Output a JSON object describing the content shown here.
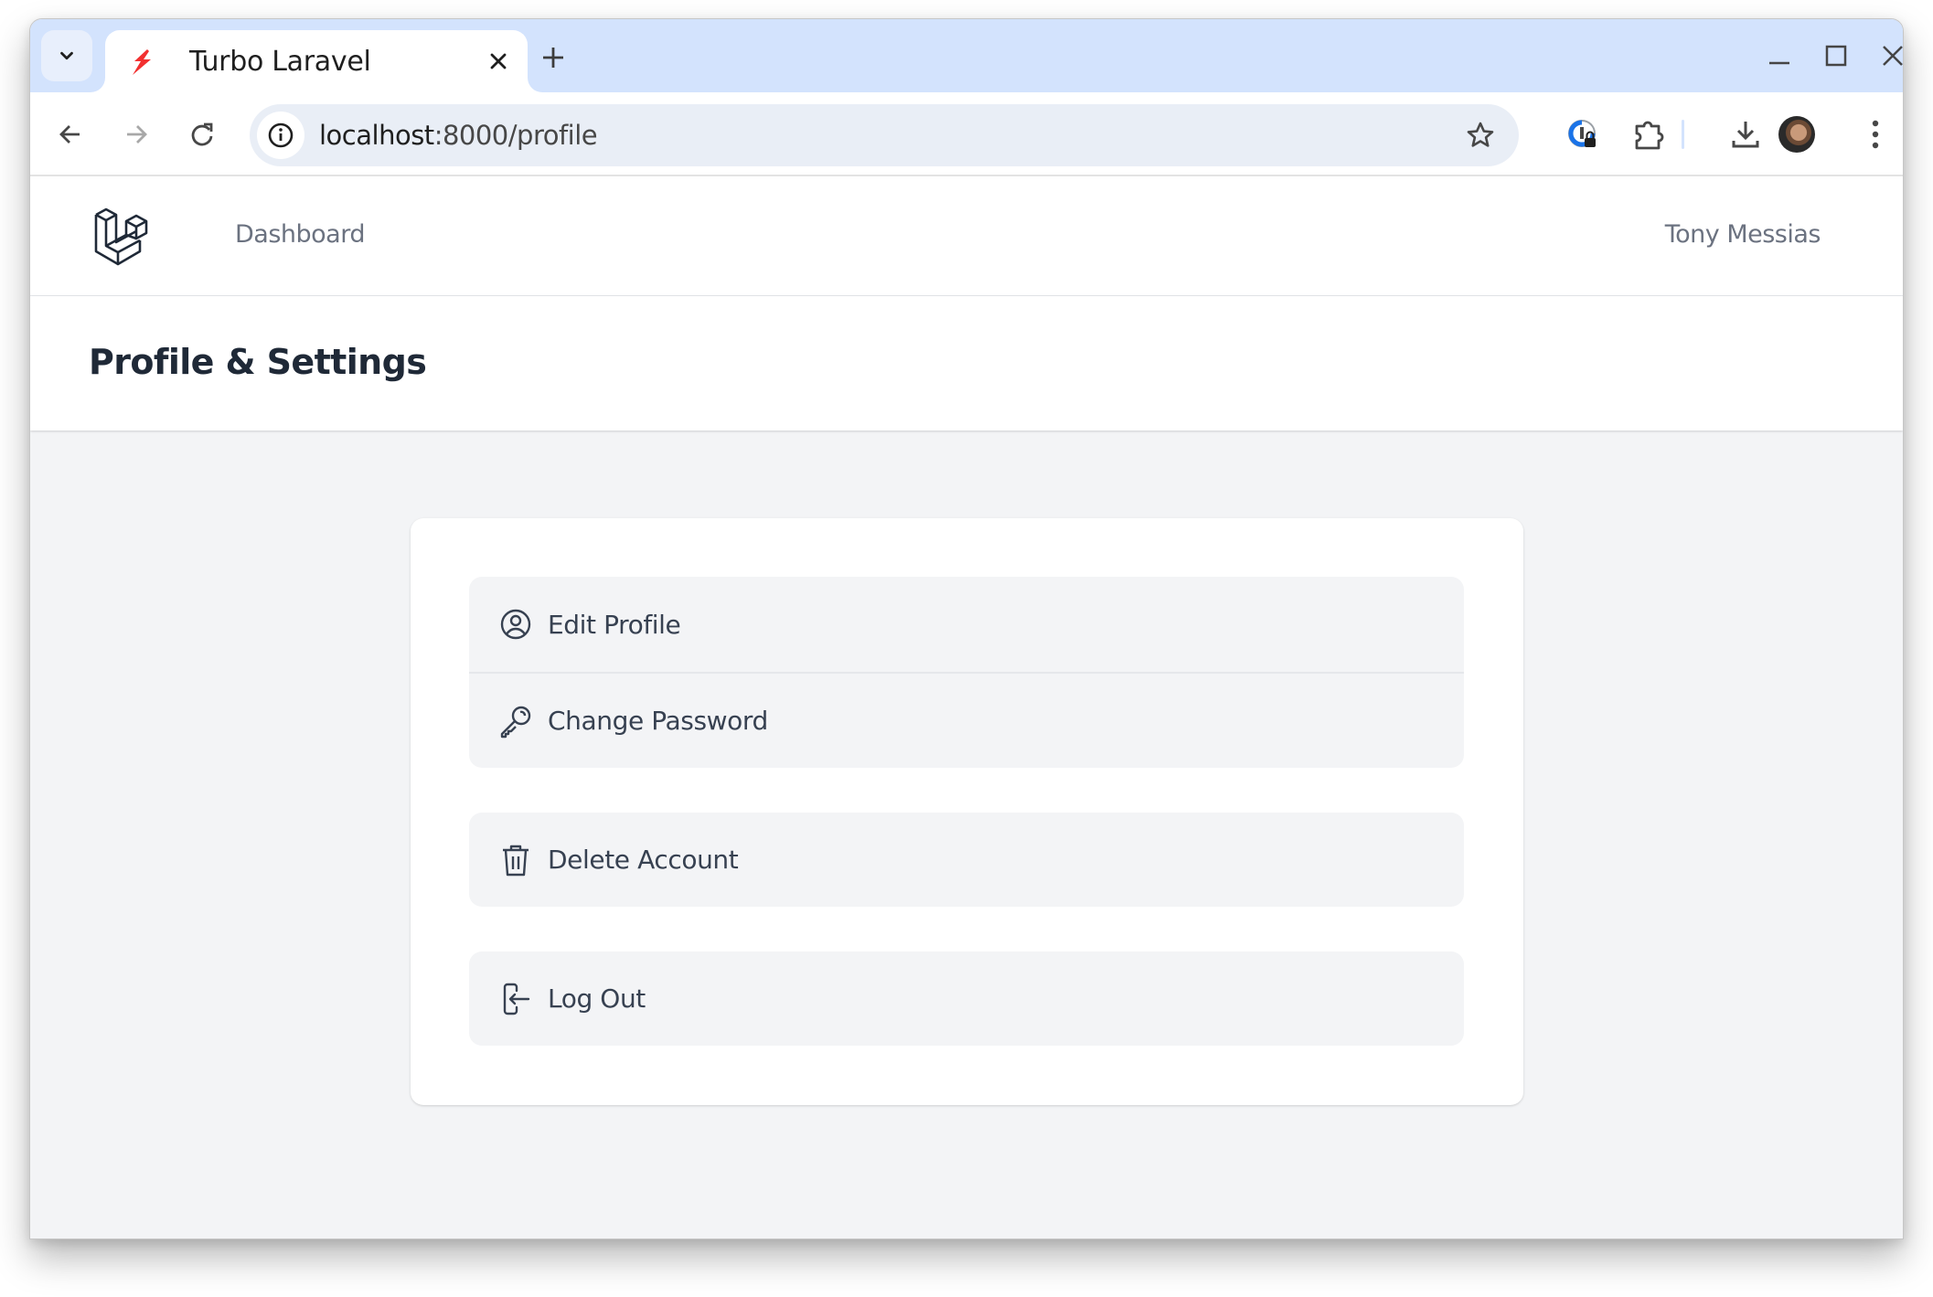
{
  "browser": {
    "tab": {
      "title": "Turbo Laravel",
      "favicon": "lightning-bolt-icon",
      "favicon_color": "#f23030"
    },
    "tab_search_icon": "chevron-down-icon",
    "new_tab_icon": "plus-icon",
    "window_controls": [
      "minimize-icon",
      "maximize-icon",
      "close-icon"
    ],
    "nav_icons": [
      "arrow-left-icon",
      "arrow-right-icon",
      "reload-icon"
    ],
    "address": {
      "host": "localhost",
      "rest": ":8000/profile",
      "info_icon": "info-icon",
      "bookmark_icon": "star-icon"
    },
    "extensions": [
      "password-manager-icon",
      "puzzle-icon"
    ],
    "download_icon": "download-icon",
    "menu_icon": "more-vertical-icon",
    "colors": {
      "tabstrip": "#d3e3fd",
      "omnibox": "#e9eef6"
    }
  },
  "app": {
    "nav": {
      "logo": "laravel-logo-icon",
      "links": [
        {
          "label": "Dashboard"
        }
      ],
      "user_name": "Tony Messias"
    },
    "header": {
      "title": "Profile & Settings"
    },
    "menu": {
      "groups": [
        {
          "items": [
            {
              "label": "Edit Profile",
              "icon": "user-circle-icon"
            },
            {
              "label": "Change Password",
              "icon": "key-icon"
            }
          ]
        },
        {
          "items": [
            {
              "label": "Delete Account",
              "icon": "trash-icon"
            }
          ]
        },
        {
          "items": [
            {
              "label": "Log Out",
              "icon": "logout-icon"
            }
          ]
        }
      ]
    },
    "colors": {
      "text": "#374151",
      "muted": "#6b7280",
      "heading": "#1f2937",
      "background": "#f3f4f6",
      "item_bg": "#f3f4f6"
    }
  }
}
